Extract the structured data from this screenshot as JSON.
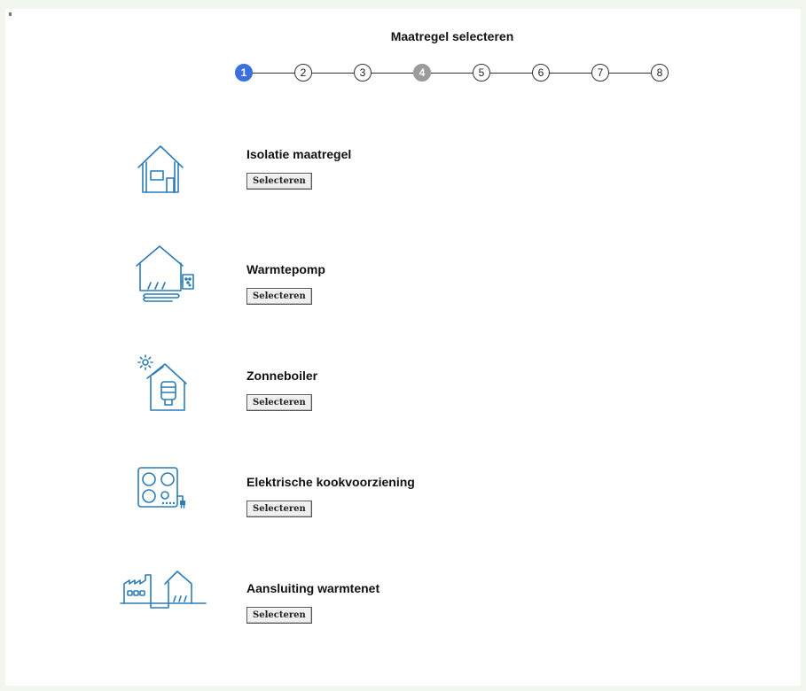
{
  "header": {
    "title": "Maatregel selecteren"
  },
  "stepper": {
    "steps": [
      {
        "label": "1",
        "state": "active"
      },
      {
        "label": "2",
        "state": "default"
      },
      {
        "label": "3",
        "state": "default"
      },
      {
        "label": "4",
        "state": "visited"
      },
      {
        "label": "5",
        "state": "default"
      },
      {
        "label": "6",
        "state": "default"
      },
      {
        "label": "7",
        "state": "default"
      },
      {
        "label": "8",
        "state": "default"
      }
    ],
    "colors": {
      "active": "#3b6fe0",
      "visited": "#9b9b9b"
    }
  },
  "measures": [
    {
      "title": "Isolatie maatregel",
      "button": "Selecteren",
      "icon": "house-insulation-icon"
    },
    {
      "title": "Warmtepomp",
      "button": "Selecteren",
      "icon": "heat-pump-icon"
    },
    {
      "title": "Zonneboiler",
      "button": "Selecteren",
      "icon": "solar-boiler-icon"
    },
    {
      "title": "Elektrische kookvoorziening",
      "button": "Selecteren",
      "icon": "electric-cooktop-icon"
    },
    {
      "title": "Aansluiting warmtenet",
      "button": "Selecteren",
      "icon": "district-heating-icon"
    }
  ],
  "theme": {
    "icon_color": "#2c7cb8",
    "background": "#f1f7ee"
  }
}
